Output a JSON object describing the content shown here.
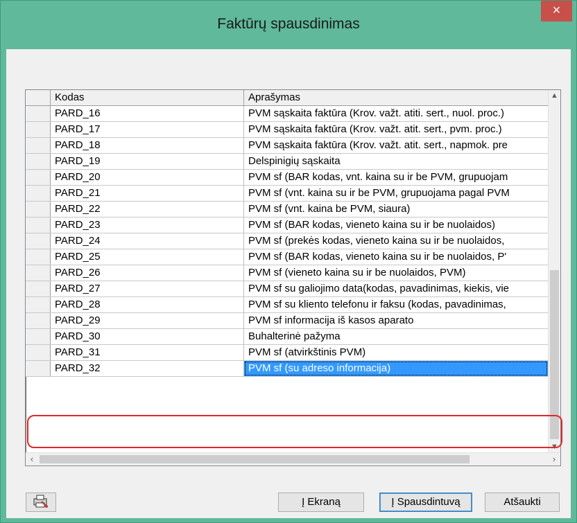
{
  "window": {
    "title": "Faktūrų spausdinimas",
    "close_symbol": "×"
  },
  "grid": {
    "columns": [
      "Kodas",
      "Aprašymas"
    ],
    "rows": [
      {
        "code": "PARD_16",
        "desc": "PVM sąskaita faktūra (Krov. važt. atiti. sert., nuol. proc.)"
      },
      {
        "code": "PARD_17",
        "desc": "PVM sąskaita faktūra (Krov. važt. atit. sert., pvm. proc.)"
      },
      {
        "code": "PARD_18",
        "desc": "PVM sąskaita faktūra (Krov. važt. atit. sert., napmok. pre"
      },
      {
        "code": "PARD_19",
        "desc": "Delspinigių sąskaita"
      },
      {
        "code": "PARD_20",
        "desc": "PVM sf (BAR kodas, vnt. kaina su ir be PVM, grupuojam"
      },
      {
        "code": "PARD_21",
        "desc": "PVM sf (vnt. kaina su ir be PVM, grupuojama pagal PVM"
      },
      {
        "code": "PARD_22",
        "desc": "PVM sf (vnt. kaina be PVM, siaura)"
      },
      {
        "code": "PARD_23",
        "desc": "PVM sf (BAR kodas, vieneto kaina su ir be nuolaidos)"
      },
      {
        "code": "PARD_24",
        "desc": "PVM sf (prekės kodas, vieneto kaina su ir be nuolaidos,"
      },
      {
        "code": "PARD_25",
        "desc": "PVM sf (BAR kodas, vieneto kaina su ir be nuolaidos, P'"
      },
      {
        "code": "PARD_26",
        "desc": "PVM sf (vieneto kaina su ir be nuolaidos, PVM)"
      },
      {
        "code": "PARD_27",
        "desc": "PVM sf su galiojimo data(kodas, pavadinimas, kiekis, vie"
      },
      {
        "code": "PARD_28",
        "desc": "PVM sf su kliento telefonu ir faksu (kodas, pavadinimas,"
      },
      {
        "code": "PARD_29",
        "desc": "PVM sf informacija iš kasos aparato"
      },
      {
        "code": "PARD_30",
        "desc": "Buhalterinė pažyma"
      },
      {
        "code": "PARD_31",
        "desc": "PVM sf (atvirkštinis PVM)"
      },
      {
        "code": "PARD_32",
        "desc": "PVM sf (su adreso informacija)",
        "selected": true
      }
    ]
  },
  "buttons": {
    "icon": "printer-setup-icon",
    "screen": "Į Ekraną",
    "printer": "Į Spausdintuvą",
    "cancel": "Atšaukti"
  },
  "colors": {
    "title_bg": "#5fb99a",
    "close_bg": "#c7504a",
    "selection": "#3399ff",
    "highlight_oval": "#e1262a"
  }
}
